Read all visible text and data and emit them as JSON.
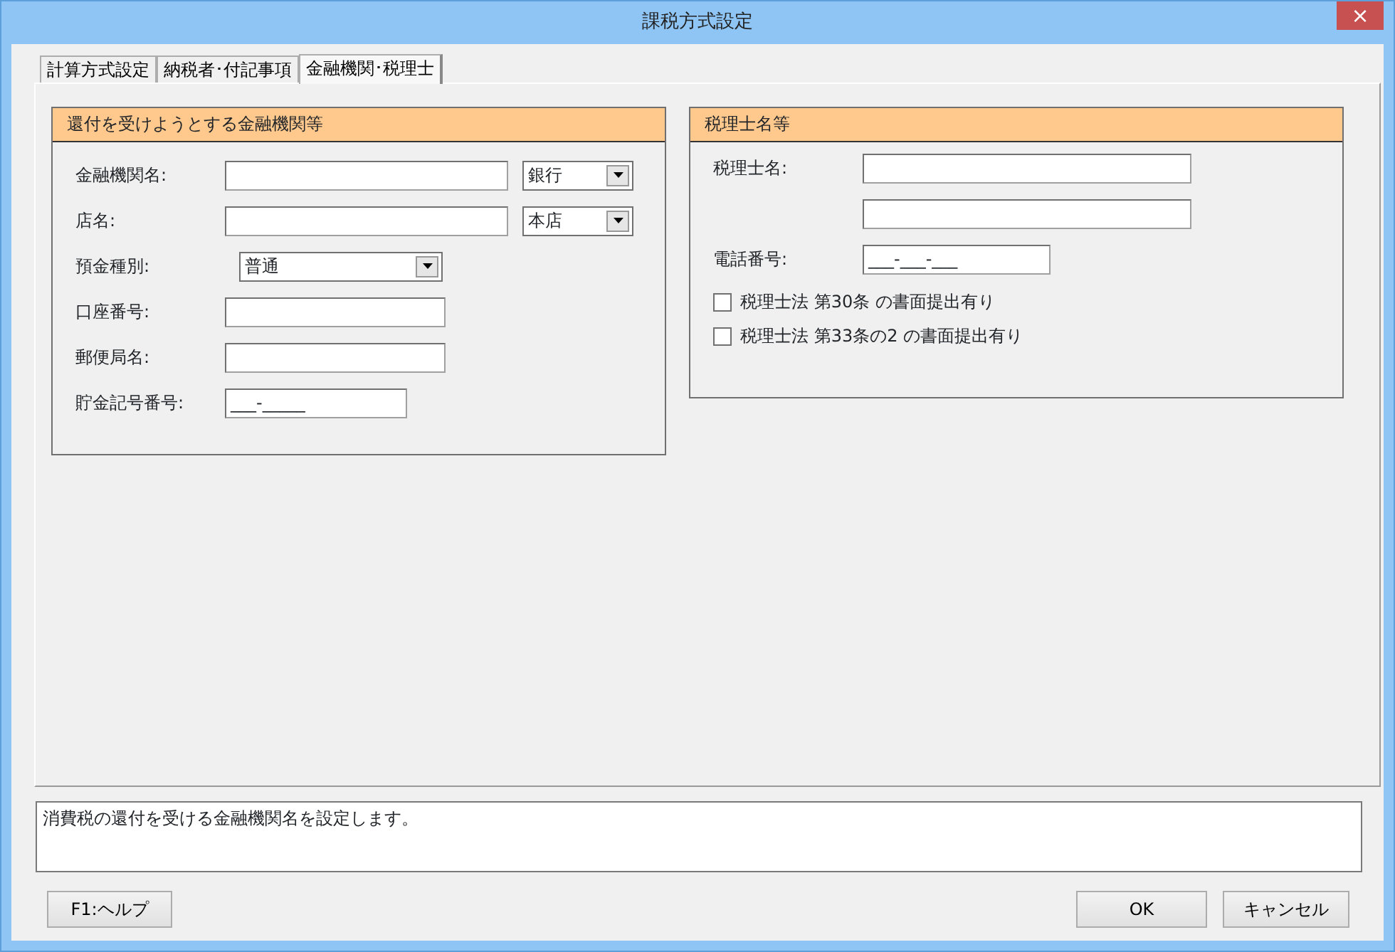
{
  "window": {
    "title": "課税方式設定",
    "close": "×"
  },
  "tabs": [
    {
      "label": "計算方式設定",
      "selected": false
    },
    {
      "label": "納税者･付記事項",
      "selected": false
    },
    {
      "label": "金融機関･税理士",
      "selected": true
    }
  ],
  "bank_group": {
    "title": "還付を受けようとする金融機関等",
    "fields": [
      {
        "kind": "text_combo",
        "label": "金融機関名:",
        "combo_value": "銀行"
      },
      {
        "kind": "text_combo",
        "label": "店名:",
        "combo_value": "本店"
      },
      {
        "kind": "combo",
        "label": "預金種別:",
        "combo_value": "普通"
      },
      {
        "kind": "text",
        "label": "口座番号:"
      },
      {
        "kind": "text",
        "label": "郵便局名:"
      },
      {
        "kind": "masked",
        "label": "貯金記号番号:",
        "value": "___-_____"
      }
    ]
  },
  "accountant_group": {
    "title": "税理士名等",
    "fields": [
      {
        "kind": "text",
        "label": "税理士名:"
      },
      {
        "kind": "text"
      },
      {
        "kind": "masked",
        "label": "電話番号:",
        "value": "___-___-___"
      }
    ],
    "checkboxes": [
      {
        "label": "税理士法 第30条 の書面提出有り",
        "checked": false
      },
      {
        "label": "税理士法 第33条の2 の書面提出有り",
        "checked": false
      }
    ]
  },
  "status_text": "消費税の還付を受ける金融機関名を設定します。",
  "buttons": {
    "help": "F1:ヘルプ",
    "ok": "OK",
    "cancel": "キャンセル"
  }
}
